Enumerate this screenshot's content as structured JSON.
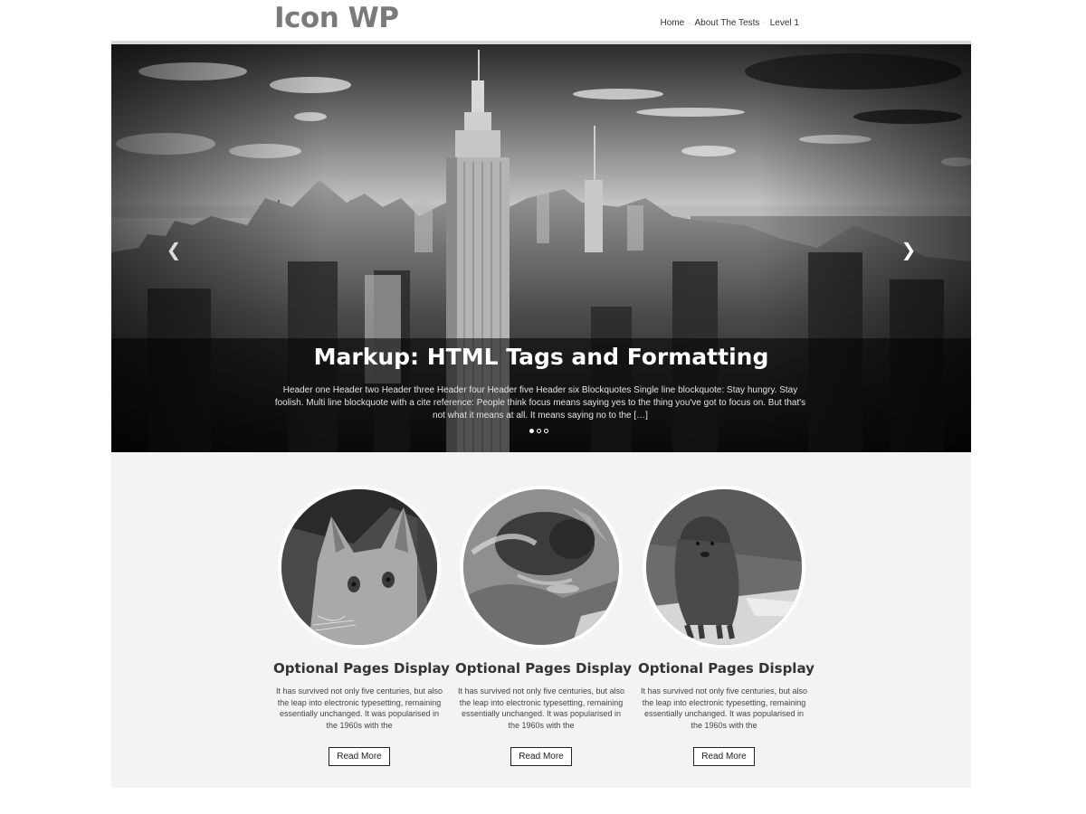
{
  "header": {
    "site_title": "Icon WP",
    "nav": [
      {
        "label": "Home"
      },
      {
        "label": "About The Tests"
      },
      {
        "label": "Level 1"
      }
    ]
  },
  "hero": {
    "title": "Markup: HTML Tags and Formatting",
    "excerpt": "Header one Header two Header three Header four Header five Header six Blockquotes Single line blockquote: Stay hungry. Stay foolish. Multi line blockquote with a cite reference: People think focus means saying yes to the thing you've got to focus on. But that's not what it means at all. It means saying no to the […]",
    "prev_icon": "chevron-left-icon",
    "next_icon": "chevron-right-icon",
    "slide_count": 3,
    "active_slide": 1
  },
  "features": [
    {
      "image": "cat-photo",
      "title": "Optional Pages Display",
      "text": "It has survived not only five centuries, but also the leap into electronic typesetting, remaining essentially unchanged. It was popularised in the 1960s with the",
      "button": "Read More"
    },
    {
      "image": "bee-photo",
      "title": "Optional Pages Display",
      "text": "It has survived not only five centuries, but also the leap into electronic typesetting, remaining essentially unchanged. It was popularised in the 1960s with the",
      "button": "Read More"
    },
    {
      "image": "dog-photo",
      "title": "Optional Pages Display",
      "text": "It has survived not only five centuries, but also the leap into electronic typesetting, remaining essentially unchanged. It was popularised in the 1960s with the",
      "button": "Read More"
    }
  ],
  "colors": {
    "title_gray": "#7a7a7a",
    "section_bg": "#f3f3f3",
    "text_dark": "#333333"
  }
}
